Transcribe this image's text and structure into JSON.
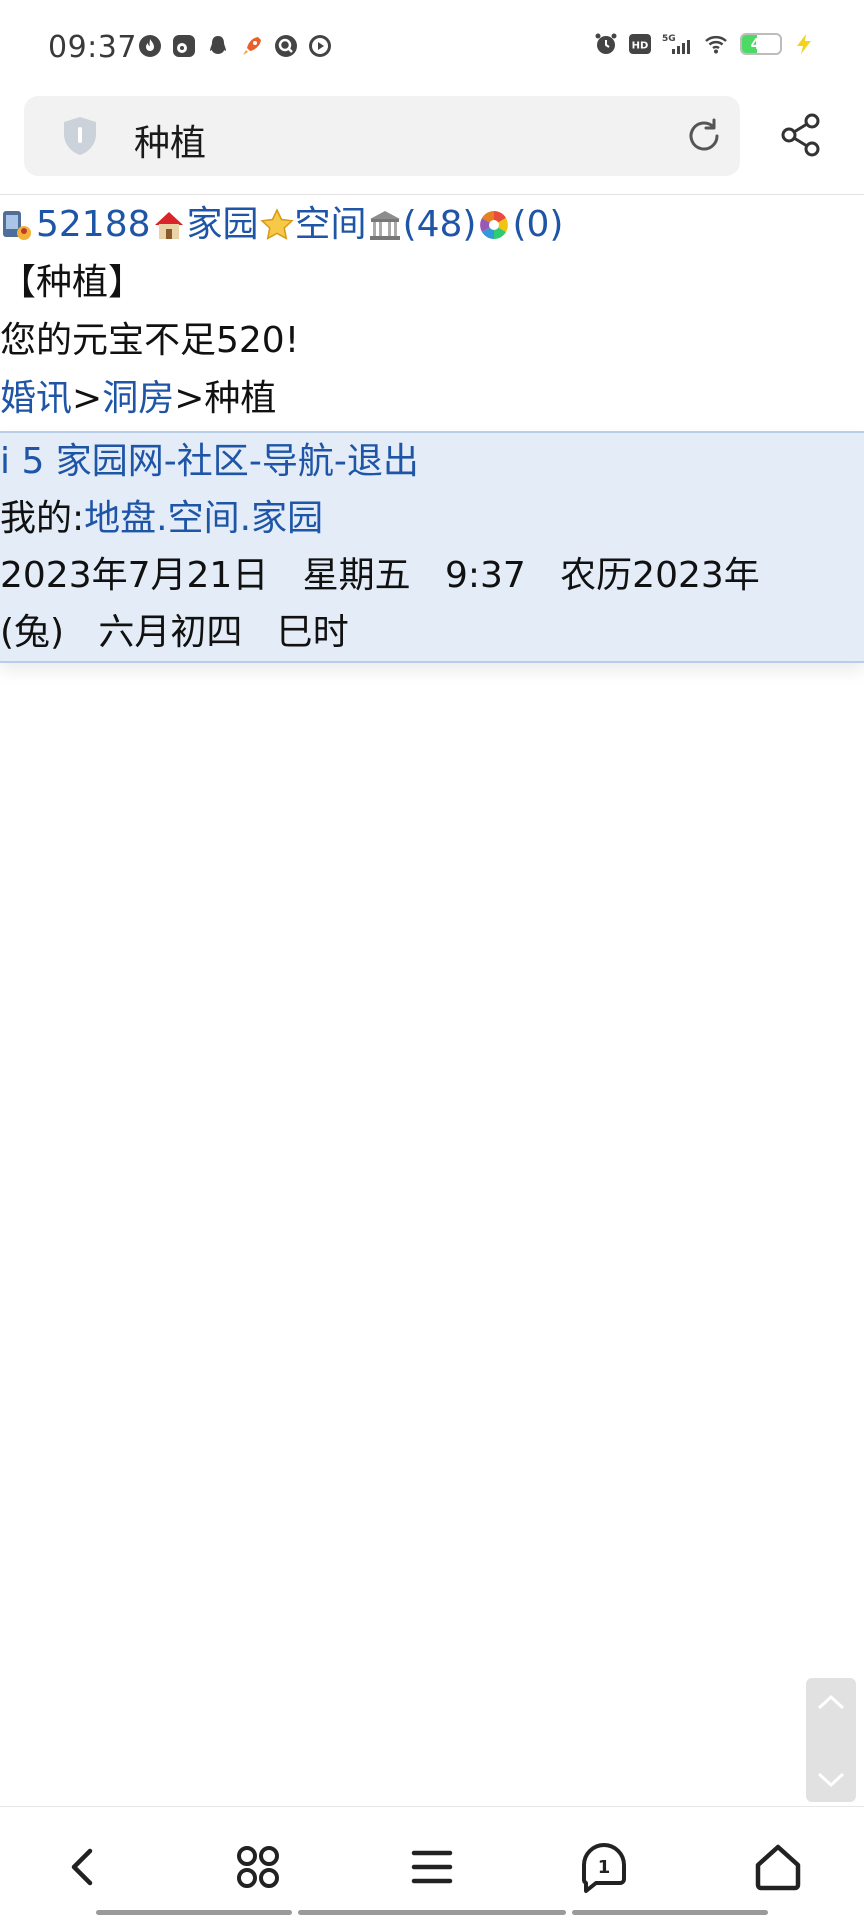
{
  "status_bar": {
    "time": "09:37",
    "left_icons": [
      "fire-app-icon",
      "weibo-icon",
      "qq-icon",
      "rocket-icon",
      "search-app-icon",
      "play-icon"
    ],
    "right_icons": [
      "alarm-icon",
      "hd-icon",
      "signal-5g-icon",
      "wifi-icon",
      "battery-icon",
      "charging-icon"
    ],
    "network": "5G",
    "battery_level": "40",
    "hd_label": "HD"
  },
  "address_bar": {
    "title": "种植",
    "left_icon": "shield-icon",
    "right_icon": "reload-icon"
  },
  "share_icon": "share-icon",
  "page": {
    "top_row": {
      "user_id": "52188",
      "home_link": "家园",
      "space_link": "空间",
      "count_a": "(48)",
      "count_b": "(0)"
    },
    "heading": "【种植】",
    "message": "您的元宝不足520!",
    "breadcrumb": {
      "item1": "婚讯",
      "sep1": ">",
      "item2": "洞房",
      "sep2": ">",
      "current": "种植"
    }
  },
  "footer": {
    "nav": {
      "site": "i 5 家园网",
      "sep1": "-",
      "community": "社区",
      "sep2": "-",
      "guide": "导航",
      "sep3": "-",
      "logout": "退出"
    },
    "mine_label": "我的:",
    "mine_links": {
      "land": "地盘",
      "dot1": ".",
      "space": "空间",
      "dot2": ".",
      "home": "家园"
    },
    "date_line1": "2023年7月21日   星期五   9:37   农历2023年",
    "date_line2": "(兔)   六月初四   巳时"
  },
  "bottom_nav": {
    "icons": [
      "back-icon",
      "apps-icon",
      "menu-icon",
      "tabs-icon",
      "home-icon"
    ],
    "tab_count": "1"
  },
  "colors": {
    "link": "#1e55a6",
    "footer_bg": "#e3ecf7",
    "footer_border": "#b7cde8",
    "address_bg": "#f2f2f2",
    "battery": "#4cd964",
    "charging": "#f5d31c"
  }
}
